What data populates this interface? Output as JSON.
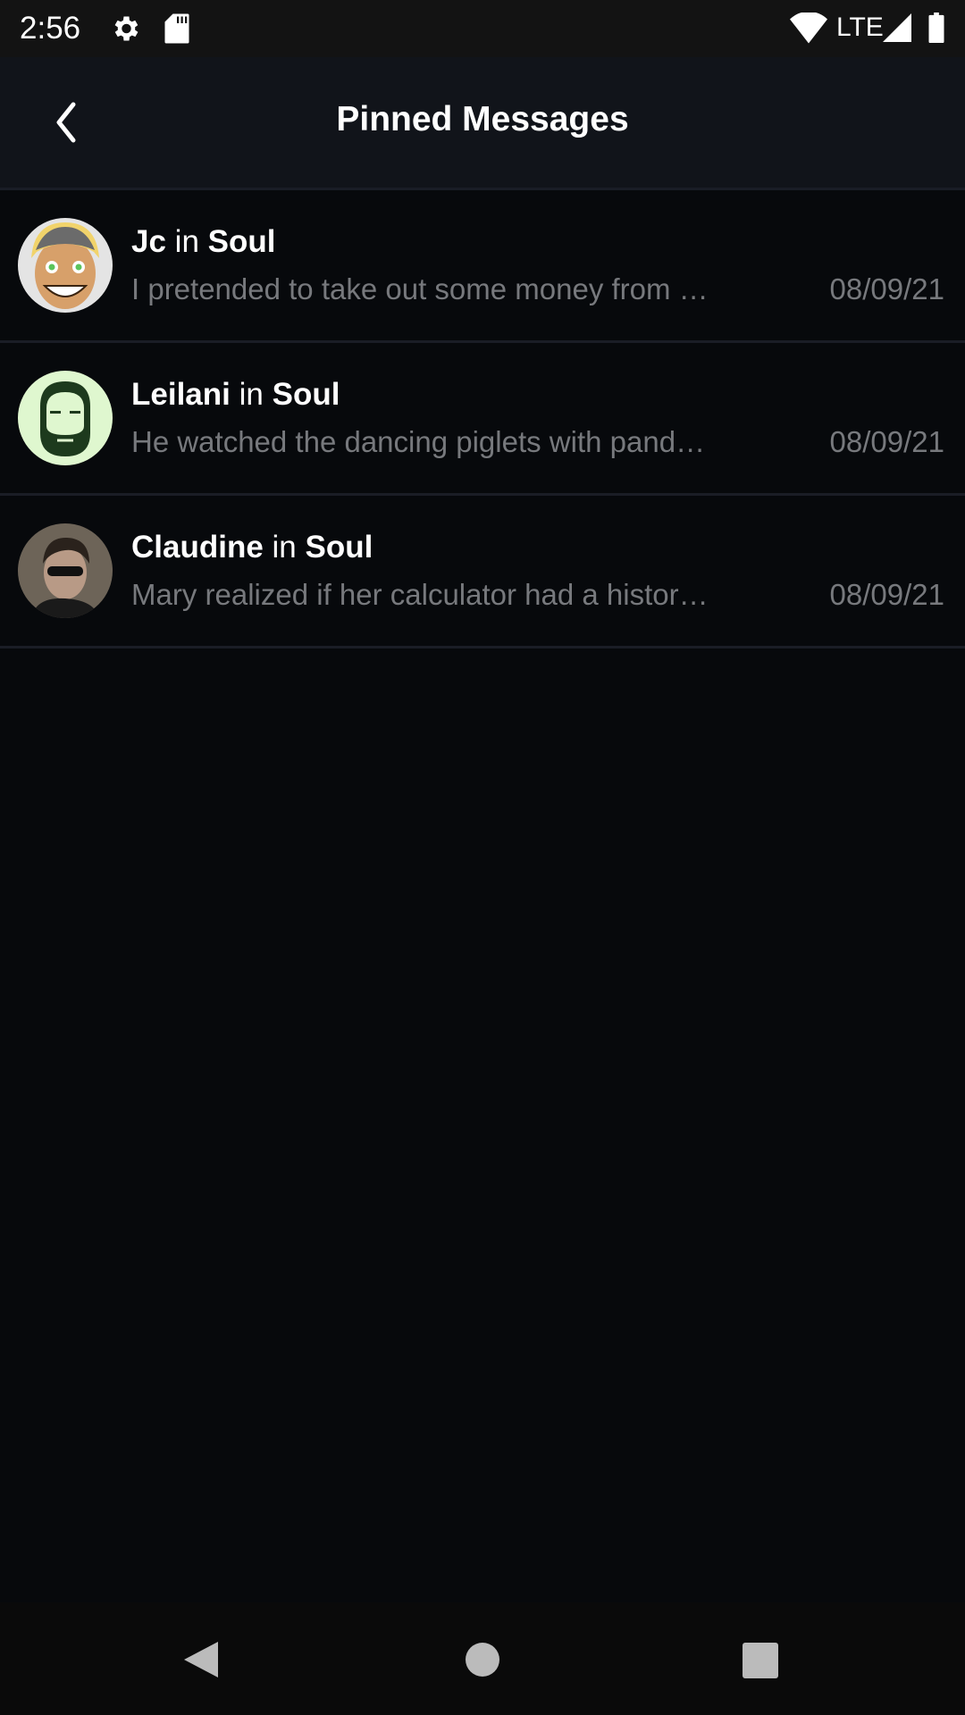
{
  "status_bar": {
    "time": "2:56",
    "network": "LTE",
    "icons": [
      "gear-icon",
      "sd-card-icon",
      "wifi-icon",
      "signal-icon",
      "battery-icon"
    ]
  },
  "header": {
    "title": "Pinned Messages",
    "back_icon": "chevron-left-icon"
  },
  "messages": [
    {
      "author": "Jc",
      "connector": "in",
      "channel": "Soul",
      "preview": "I pretended to take out some money from …",
      "date": "08/09/21"
    },
    {
      "author": "Leilani",
      "connector": "in",
      "channel": "Soul",
      "preview": "He watched the dancing piglets with pand…",
      "date": "08/09/21"
    },
    {
      "author": "Claudine",
      "connector": "in",
      "channel": "Soul",
      "preview": "Mary realized if her calculator had a histor…",
      "date": "08/09/21"
    }
  ],
  "colors": {
    "background": "#07090c",
    "header": "#11141a",
    "status_bar": "#131313",
    "divider": "#1a1d26",
    "secondary_text": "#77797d"
  }
}
